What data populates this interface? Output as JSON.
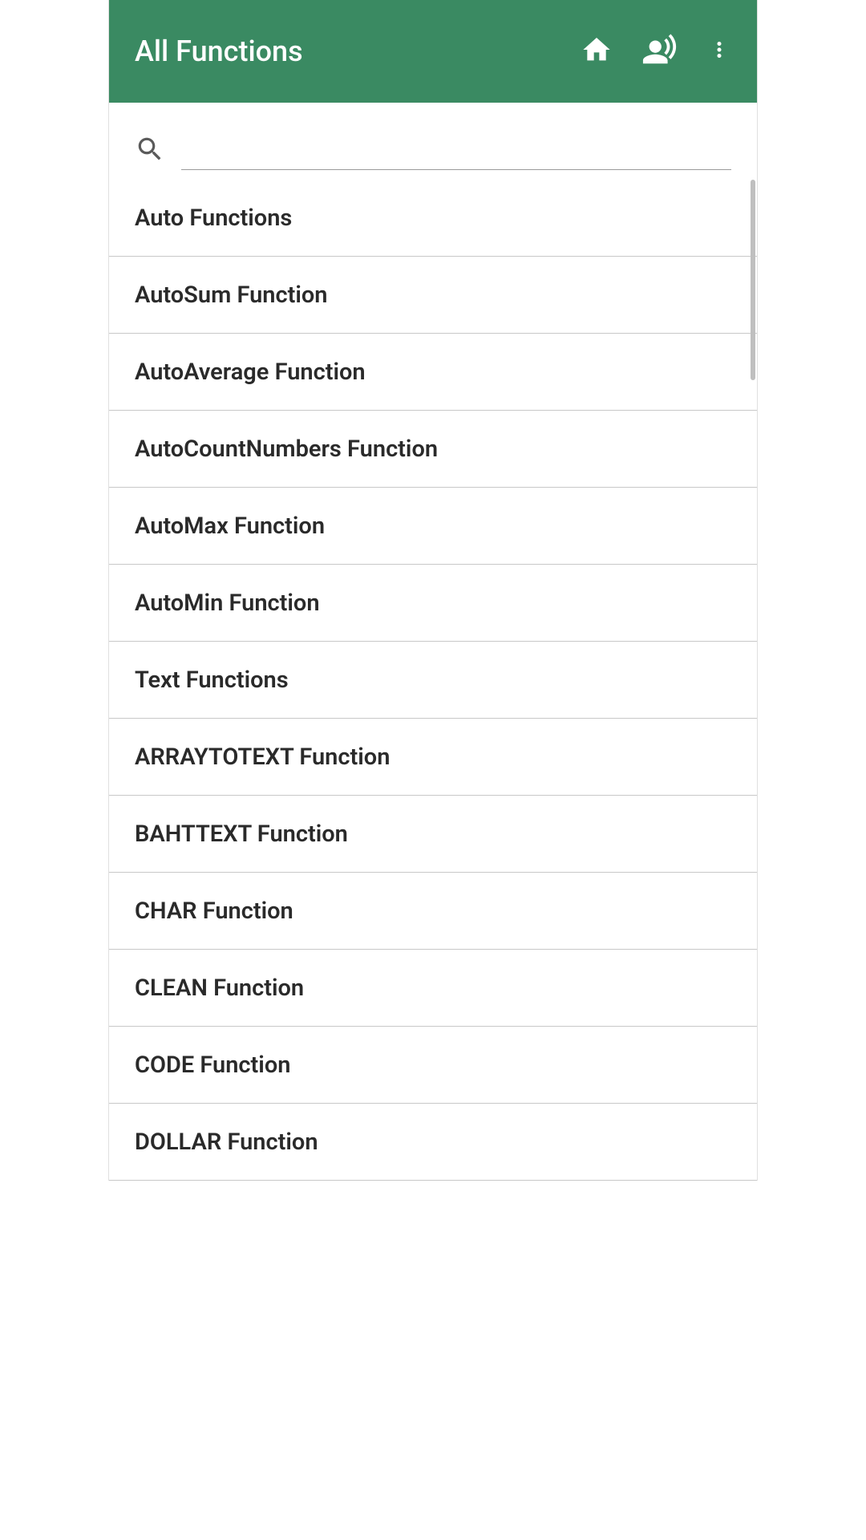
{
  "header": {
    "title": "All Functions"
  },
  "search": {
    "value": "",
    "placeholder": ""
  },
  "list": {
    "items": [
      {
        "label": "Auto Functions"
      },
      {
        "label": "AutoSum Function"
      },
      {
        "label": "AutoAverage Function"
      },
      {
        "label": "AutoCountNumbers Function"
      },
      {
        "label": "AutoMax Function"
      },
      {
        "label": "AutoMin Function"
      },
      {
        "label": "Text Functions"
      },
      {
        "label": "ARRAYTOTEXT Function"
      },
      {
        "label": "BAHTTEXT Function"
      },
      {
        "label": "CHAR Function"
      },
      {
        "label": "CLEAN Function"
      },
      {
        "label": "CODE Function"
      },
      {
        "label": "DOLLAR Function"
      }
    ]
  }
}
